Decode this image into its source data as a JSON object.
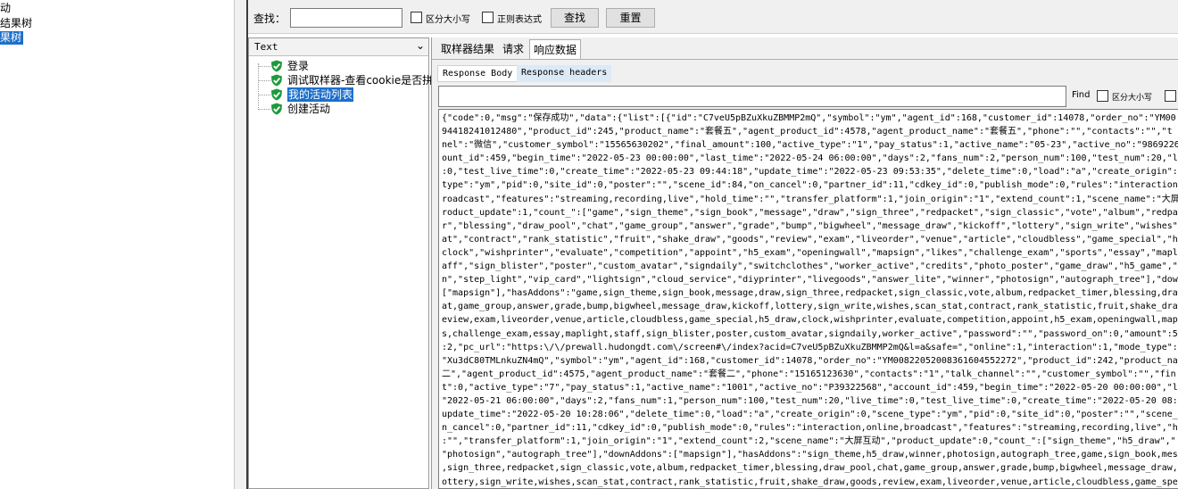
{
  "left_tree": {
    "items": [
      {
        "label": "动",
        "selected": false
      },
      {
        "label": "结果树",
        "selected": false
      },
      {
        "label": "果树",
        "selected": true
      }
    ]
  },
  "search": {
    "label": "查找：",
    "input_value": "",
    "case_label": "区分大小写",
    "regex_label": "正则表达式",
    "find_button": "查找",
    "reset_button": "重置"
  },
  "tree": {
    "renderer": "Text",
    "nodes": [
      {
        "label": "登录",
        "selected": false,
        "icon": "shield-check-icon"
      },
      {
        "label": "调试取样器-查看cookie是否拼",
        "selected": false,
        "icon": "shield-check-icon"
      },
      {
        "label": "我的活动列表",
        "selected": true,
        "icon": "shield-check-icon"
      },
      {
        "label": "创建活动",
        "selected": false,
        "icon": "shield-check-icon"
      }
    ]
  },
  "result": {
    "tabs": [
      "取样器结果",
      "请求",
      "响应数据"
    ],
    "active_tab": 2,
    "subtabs": [
      "Response Body",
      "Response headers"
    ],
    "find_label": "Find",
    "find_case_label": "区分大小写",
    "body_lines": [
      "{\"code\":0,\"msg\":\"保存成功\",\"data\":{\"list\":[{\"id\":\"C7veU5pBZuXkuZBMMP2mQ\",\"symbol\":\"ym\",\"agent_id\":168,\"customer_id\":14078,\"order_no\":\"YM00",
      "94418241012480\",\"product_id\":245,\"product_name\":\"套餐五\",\"agent_product_id\":4578,\"agent_product_name\":\"套餐五\",\"phone\":\"\",\"contacts\":\"\",\"t",
      "nel\":\"微信\",\"customer_symbol\":\"15565630202\",\"final_amount\":100,\"active_type\":\"1\",\"pay_status\":1,\"active_name\":\"05-23\",\"active_no\":\"9869226",
      "ount_id\":459,\"begin_time\":\"2022-05-23 00:00:00\",\"last_time\":\"2022-05-24 06:00:00\",\"days\":2,\"fans_num\":2,\"person_num\":100,\"test_num\":20,\"li",
      ":0,\"test_live_time\":0,\"create_time\":\"2022-05-23 09:44:18\",\"update_time\":\"2022-05-23 09:53:35\",\"delete_time\":0,\"load\":\"a\",\"create_origin\":0",
      "type\":\"ym\",\"pid\":0,\"site_id\":0,\"poster\":\"\",\"scene_id\":84,\"on_cancel\":0,\"partner_id\":11,\"cdkey_id\":0,\"publish_mode\":0,\"rules\":\"interaction,",
      "roadcast\",\"features\":\"streaming,recording,live\",\"hold_time\":\"\",\"transfer_platform\":1,\"join_origin\":\"1\",\"extend_count\":1,\"scene_name\":\"大屏",
      "roduct_update\":1,\"count_\":[\"game\",\"sign_theme\",\"sign_book\",\"message\",\"draw\",\"sign_three\",\"redpacket\",\"sign_classic\",\"vote\",\"album\",\"redpac",
      "r\",\"blessing\",\"draw_pool\",\"chat\",\"game_group\",\"answer\",\"grade\",\"bump\",\"bigwheel\",\"message_draw\",\"kickoff\",\"lottery\",\"sign_write\",\"wishes\",",
      "at\",\"contract\",\"rank_statistic\",\"fruit\",\"shake_draw\",\"goods\",\"review\",\"exam\",\"liveorder\",\"venue\",\"article\",\"cloudbless\",\"game_special\",\"h5",
      "clock\",\"wishprinter\",\"evaluate\",\"competition\",\"appoint\",\"h5_exam\",\"openingwall\",\"mapsign\",\"likes\",\"challenge_exam\",\"sports\",\"essay\",\"mapli",
      "aff\",\"sign_blister\",\"poster\",\"custom_avatar\",\"signdaily\",\"switchclothes\",\"worker_active\",\"credits\",\"photo_poster\",\"game_draw\",\"h5_game\",\"l",
      "n\",\"step_light\",\"vip_card\",\"lightsign\",\"cloud_service\",\"diyprinter\",\"livegoods\",\"answer_lite\",\"winner\",\"photosign\",\"autograph_tree\"],\"down",
      "[\"mapsign\"],\"hasAddons\":\"game,sign_theme,sign_book,message,draw,sign_three,redpacket,sign_classic,vote,album,redpacket_timer,blessing,draw_",
      "at,game_group,answer,grade,bump,bigwheel,message_draw,kickoff,lottery,sign_write,wishes,scan_stat,contract,rank_statistic,fruit,shake_draw",
      "eview,exam,liveorder,venue,article,cloudbless,game_special,h5_draw,clock,wishprinter,evaluate,competition,appoint,h5_exam,openingwall,maps",
      "s,challenge_exam,essay,maplight,staff,sign_blister,poster,custom_avatar,signdaily,worker_active\",\"password\":\"\",\"password_on\":0,\"amount\":5,",
      ":2,\"pc_url\":\"https:\\/\\/prewall.hudongdt.com\\/screen#\\/index?acid=C7veU5pBZuXkuZBMMP2mQ&l=a&safe=\",\"online\":1,\"interaction\":1,\"mode_type\":1",
      "\"Xu3dC80TMLnkuZN4mQ\",\"symbol\":\"ym\",\"agent_id\":168,\"customer_id\":14078,\"order_no\":\"YM0082205200836160455​2272\",\"product_id\":242,\"product_nam",
      "二\",\"agent_product_id\":4575,\"agent_product_name\":\"套餐二\",\"phone\":\"15165123630\",\"contacts\":\"1\",\"talk_channel\":\"\",\"customer_symbol\":\"\",\"fin",
      "t\":0,\"active_type\":\"7\",\"pay_status\":1,\"active_name\":\"1001\",\"active_no\":\"P39322568\",\"account_id\":459,\"begin_time\":\"2022-05-20 00:00:00\",\"la",
      "\"2022-05-21 06:00:00\",\"days\":2,\"fans_num\":1,\"person_num\":100,\"test_num\":20,\"live_time\":0,\"test_live_time\":0,\"create_time\":\"2022-05-20 08:",
      "update_time\":\"2022-05-20 10:28:06\",\"delete_time\":0,\"load\":\"a\",\"create_origin\":0,\"scene_type\":\"ym\",\"pid\":0,\"site_id\":0,\"poster\":\"\",\"scene_i",
      "n_cancel\":0,\"partner_id\":11,\"cdkey_id\":0,\"publish_mode\":0,\"rules\":\"interaction,online,broadcast\",\"features\":\"streaming,recording,live\",\"ho",
      ":\"\",\"transfer_platform\":1,\"join_origin\":\"1\",\"extend_count\":2,\"scene_name\":\"大屏互动\",\"product_update\":0,\"count_\":[\"sign_theme\",\"h5_draw\",\"",
      "\"photosign\",\"autograph_tree\"],\"downAddons\":[\"mapsign\"],\"hasAddons\":\"sign_theme,h5_draw,winner,photosign,autograph_tree,game,sign_book,mess",
      ",sign_three,redpacket,sign_classic,vote,album,redpacket_timer,blessing,draw_pool,chat,game_group,answer,grade,bump,bigwheel,message_draw,k",
      "ottery,sign_write,wishes,scan_stat,contract,rank_statistic,fruit,shake_draw,goods,review,exam,liveorder,venue,article,cloudbless,game_spec"
    ]
  }
}
